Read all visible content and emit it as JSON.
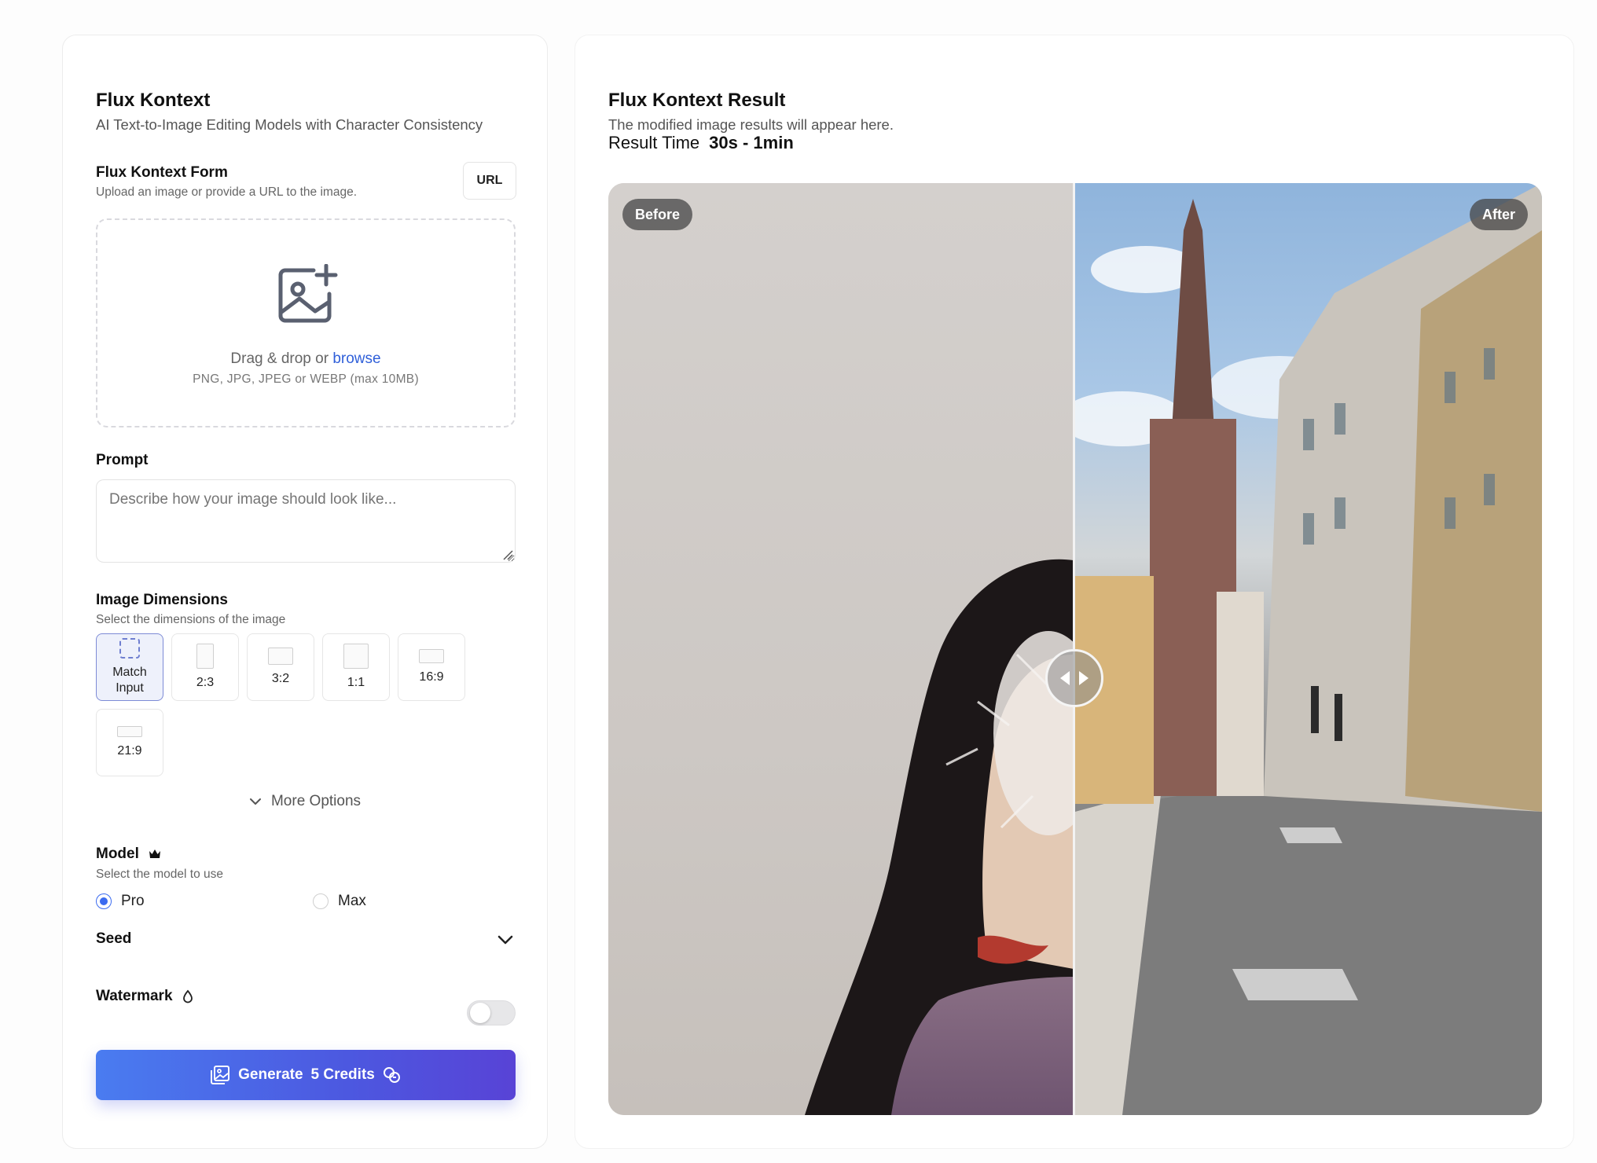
{
  "form_panel": {
    "title": "Flux Kontext",
    "subtitle": "AI Text-to-Image Editing Models with Character Consistency",
    "form_label": "Flux Kontext Form",
    "form_hint": "Upload an image or provide a URL to the image.",
    "url_button": "URL",
    "dropzone": {
      "icon": "image-plus-icon",
      "drag_text": "Drag & drop or",
      "browse_link": "browse",
      "formats": "PNG, JPG, JPEG or WEBP (max 10MB)"
    },
    "prompt": {
      "label": "Prompt",
      "placeholder": "Describe how your image should look like...",
      "value": ""
    },
    "dimensions": {
      "label": "Image Dimensions",
      "hint": "Select the dimensions of the image",
      "selected": "Match Input",
      "options": [
        {
          "label": "Match Input",
          "line1": "Match",
          "line2": "Input"
        },
        {
          "label": "2:3"
        },
        {
          "label": "3:2"
        },
        {
          "label": "1:1"
        },
        {
          "label": "16:9"
        },
        {
          "label": "21:9"
        }
      ]
    },
    "more_options": "More Options",
    "model": {
      "label": "Model",
      "badge_icon": "crown-icon",
      "hint": "Select the model to use",
      "options": [
        "Pro",
        "Max"
      ],
      "selected": "Pro"
    },
    "seed": {
      "label": "Seed",
      "icon": "chevron-down-icon"
    },
    "watermark": {
      "label": "Watermark",
      "icon": "drop-icon",
      "enabled": false
    },
    "generate": {
      "label": "Generate",
      "credits": "5 Credits",
      "icon": "gallery-icon",
      "credits_icon": "coins-icon"
    }
  },
  "result_panel": {
    "title": "Flux Kontext Result",
    "subtitle": "The modified image results will appear here.",
    "result_time_label": "Result Time",
    "result_time_value": "30s - 1min",
    "compare": {
      "before_label": "Before",
      "after_label": "After",
      "split_percent": 50
    }
  },
  "colors": {
    "accent": "#4c58e0",
    "link": "#2f5fd9",
    "radio": "#3b6bf0"
  }
}
